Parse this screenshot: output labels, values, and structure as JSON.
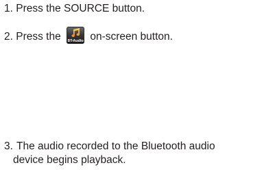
{
  "steps": [
    {
      "text": "1. Press the SOURCE button."
    },
    {
      "before": "2. Press the ",
      "after": " on-screen button.",
      "icon": {
        "name": "bt-audio-icon",
        "caption": "BT-Audio",
        "symbol": "♫"
      }
    },
    {
      "number": "3.",
      "line1": "The audio recorded to the Bluetooth audio",
      "line2": "device begins playback."
    }
  ]
}
